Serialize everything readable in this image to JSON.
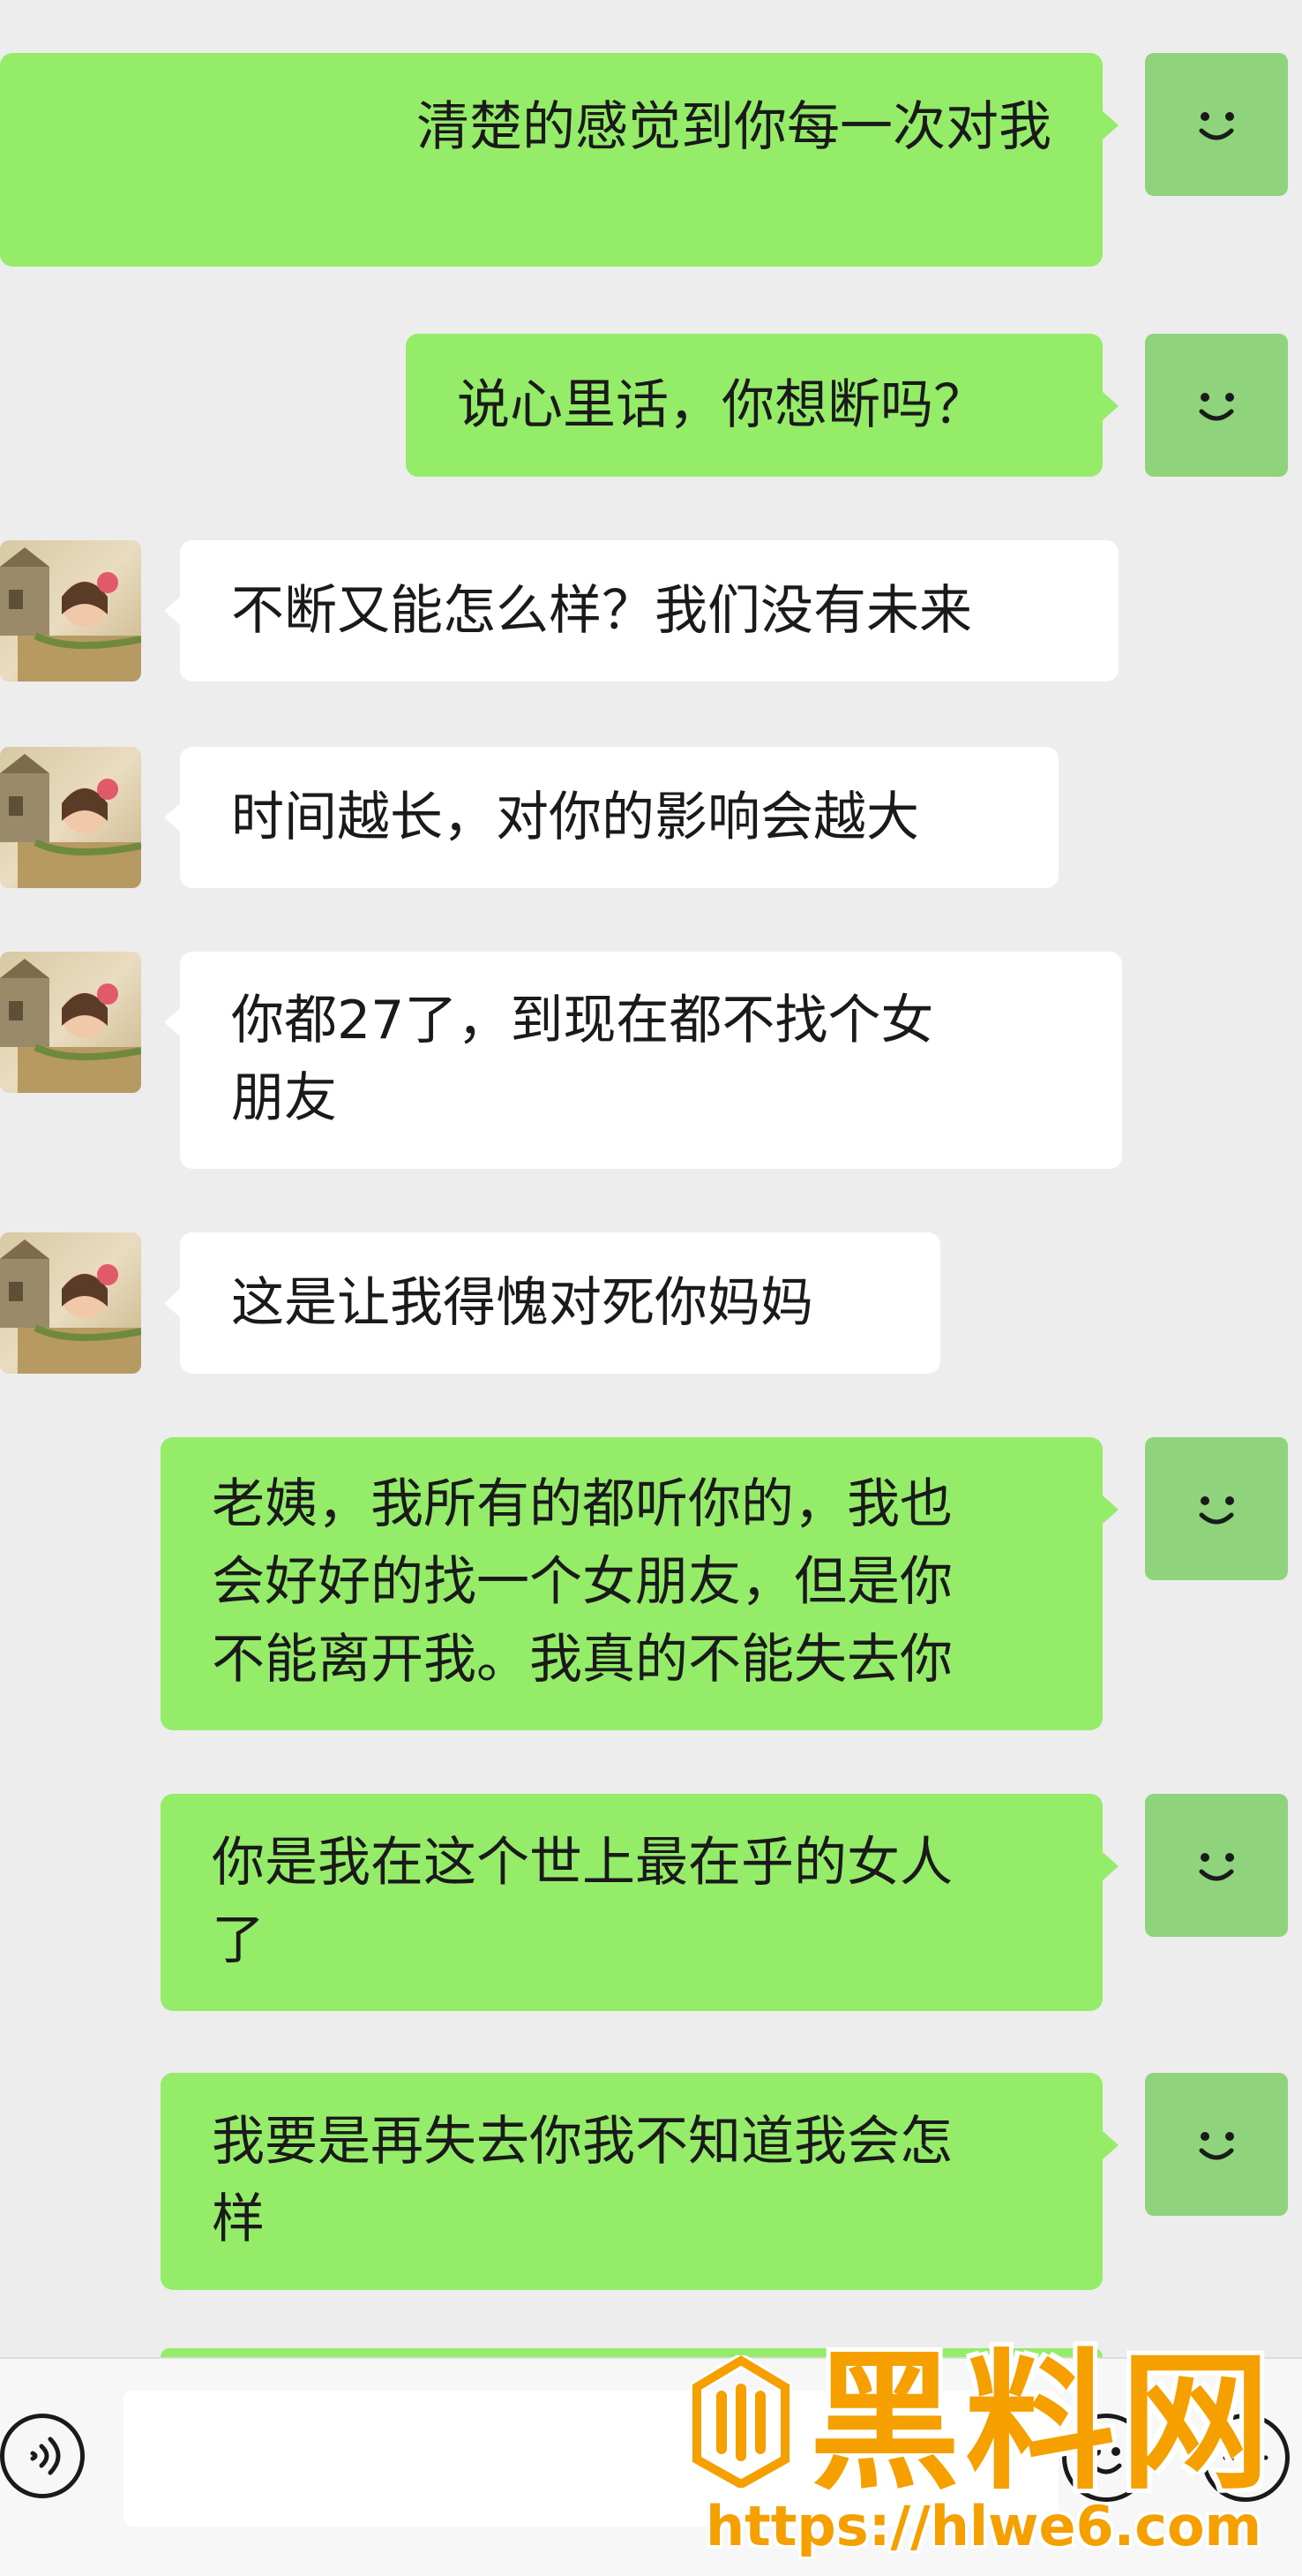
{
  "chat": {
    "messages": [
      {
        "sender": "me",
        "lines": [
          "清楚的感觉到你每一次对我"
        ]
      },
      {
        "sender": "me",
        "lines": [
          "说心里话，你想断吗？"
        ]
      },
      {
        "sender": "them",
        "lines": [
          "不断又能怎么样？我们没有未来"
        ]
      },
      {
        "sender": "them",
        "lines": [
          "时间越长，对你的影响会越大"
        ]
      },
      {
        "sender": "them",
        "lines": [
          "你都27了，到现在都不找个女",
          "朋友"
        ]
      },
      {
        "sender": "them",
        "lines": [
          "这是让我得愧对死你妈妈"
        ]
      },
      {
        "sender": "me",
        "lines": [
          "老姨，我所有的都听你的，我也",
          "会好好的找一个女朋友，但是你",
          "不能离开我。我真的不能失去你"
        ]
      },
      {
        "sender": "me",
        "lines": [
          "你是我在这个世上最在乎的女人",
          "了"
        ]
      },
      {
        "sender": "me",
        "lines": [
          "我要是再失去你我不知道我会怎",
          "样"
        ]
      }
    ]
  },
  "input_bar": {
    "voice_icon": "voice-icon",
    "emoji_icon": "emoji-icon",
    "plus_icon": "plus-icon",
    "input_value": ""
  },
  "watermark": {
    "title": "黑料网",
    "url": "https://hlwe6.com",
    "color": "#f6a000"
  },
  "colors": {
    "outgoing_bubble": "#95ec69",
    "incoming_bubble": "#ffffff",
    "background": "#ededed"
  }
}
